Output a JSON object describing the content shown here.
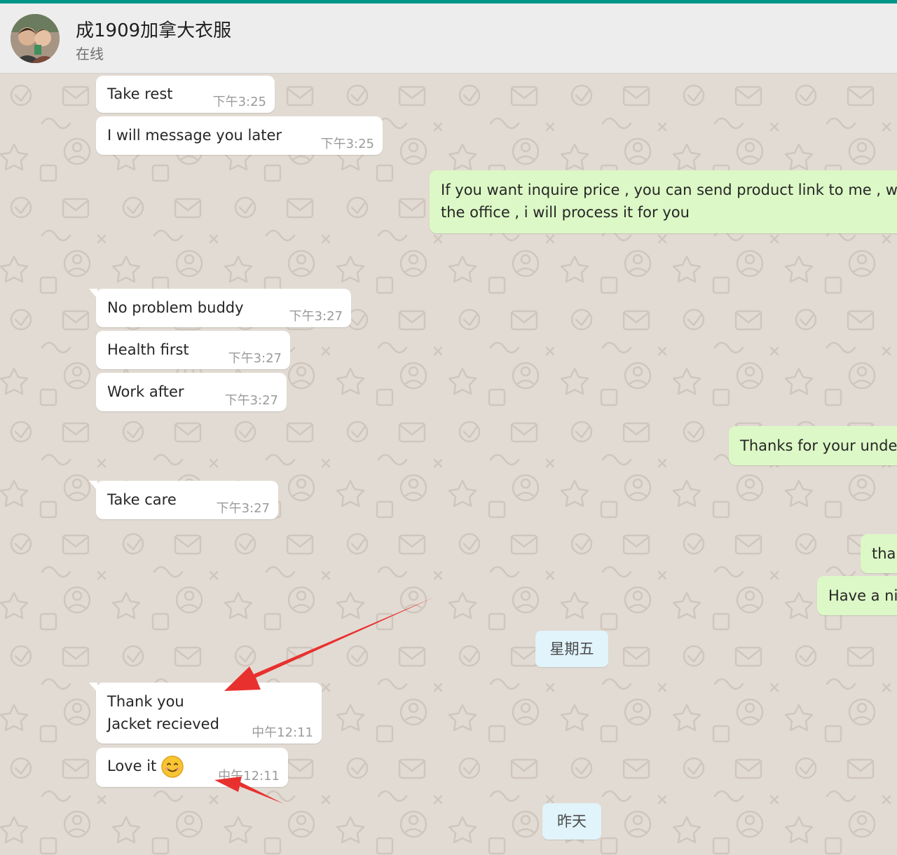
{
  "header": {
    "contact_name": "成1909加拿大衣服",
    "status": "在线"
  },
  "messages": [
    {
      "id": "m1",
      "direction": "in",
      "text": "Take rest",
      "time": "下午3:25"
    },
    {
      "id": "m2",
      "direction": "in",
      "text": "I will message you later",
      "time": "下午3:25"
    },
    {
      "id": "m3",
      "direction": "out",
      "line1": "If you want inquire price , you can send product link to me , w",
      "line2": "the office , i will process it for you"
    },
    {
      "id": "m4",
      "direction": "in",
      "text": "No problem buddy",
      "time": "下午3:27"
    },
    {
      "id": "m5",
      "direction": "in",
      "text": "Health first",
      "time": "下午3:27"
    },
    {
      "id": "m6",
      "direction": "in",
      "text": "Work after",
      "time": "下午3:27"
    },
    {
      "id": "m7",
      "direction": "out",
      "text": "Thanks for your unde"
    },
    {
      "id": "m8",
      "direction": "in",
      "text": "Take care",
      "time": "下午3:27"
    },
    {
      "id": "m9",
      "direction": "out",
      "text": "tha"
    },
    {
      "id": "m10",
      "direction": "out",
      "text": "Have a ni"
    },
    {
      "id": "m11",
      "direction": "in",
      "line1": "Thank you",
      "line2": "Jacket recieved",
      "time": "中午12:11"
    },
    {
      "id": "m12",
      "direction": "in",
      "text": "Love it",
      "time": "中午12:11"
    }
  ],
  "date_separators": {
    "friday": "星期五",
    "yesterday": "昨天"
  },
  "icons": {
    "smile_emoji": "smiling-face-emoji",
    "avatar": "contact-avatar"
  },
  "colors": {
    "accent_strip": "#009688",
    "incoming_bubble": "#ffffff",
    "outgoing_bubble": "#dcf8c6",
    "date_chip": "#e1f3fb",
    "annotation_arrow": "#e8312f"
  }
}
